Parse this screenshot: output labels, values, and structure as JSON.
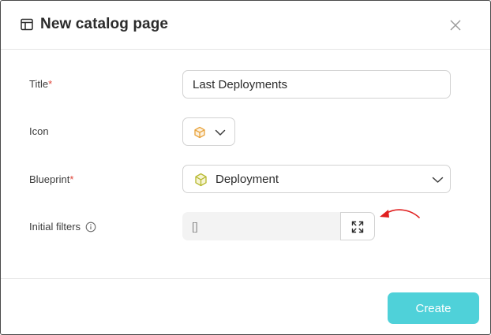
{
  "dialog": {
    "title": "New catalog page",
    "header_icon": "table-icon",
    "close_icon": "close-icon"
  },
  "form": {
    "title": {
      "label": "Title",
      "required_mark": "*",
      "value": "Last Deployments"
    },
    "icon": {
      "label": "Icon",
      "selected_icon": "cube-icon",
      "dropdown_icon": "chevron-down-icon"
    },
    "blueprint": {
      "label": "Blueprint",
      "required_mark": "*",
      "value": "Deployment",
      "value_icon": "cube-icon",
      "dropdown_icon": "chevron-down-icon"
    },
    "initial_filters": {
      "label": "Initial filters",
      "info_icon": "info-icon",
      "value": "[]",
      "expand_icon": "expand-icon"
    }
  },
  "annotation": {
    "arrow_color": "#e02020"
  },
  "footer": {
    "create_label": "Create"
  },
  "colors": {
    "primary_button": "#4fd1d9",
    "required": "#e0473b",
    "icon_orange": "#e8a23a",
    "icon_olive": "#b6b82e"
  }
}
